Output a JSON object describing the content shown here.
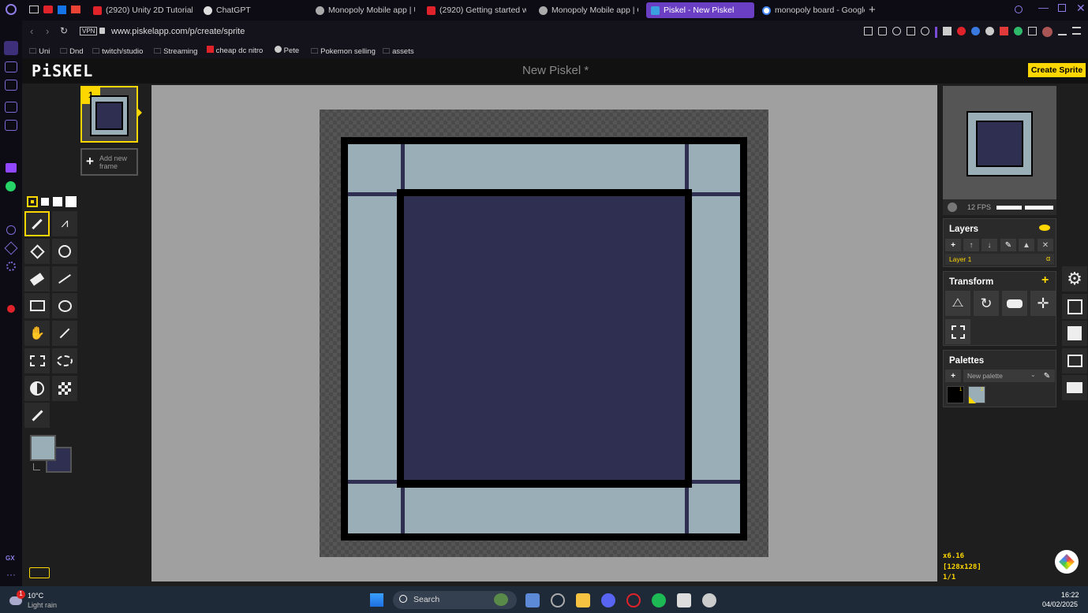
{
  "browser": {
    "tabs": [
      {
        "label": "(2920) Unity 2D Tutorial H",
        "color": "#e0222a"
      },
      {
        "label": "ChatGPT",
        "color": "#cccccc"
      },
      {
        "label": "Monopoly Mobile app | Un",
        "color": "#bbbbbb"
      },
      {
        "label": "(2920) Getting started wit",
        "color": "#e0222a"
      },
      {
        "label": "Monopoly Mobile app | Or",
        "color": "#bbbbbb"
      },
      {
        "label": "Piskel - New Piskel",
        "color": "#3aa0e0",
        "active": true
      },
      {
        "label": "monopoly board - Google",
        "color": "#4285f4"
      }
    ],
    "url": "www.piskelapp.com/p/create/sprite",
    "vpn_label": "VPN",
    "bookmarks": [
      "Uni",
      "Dnd",
      "twitch/studio",
      "Streaming",
      "cheap dc nitro",
      "Pete",
      "Pokemon selling",
      "assets"
    ]
  },
  "piskel": {
    "logo": "PiSKEL",
    "doc_title": "New Piskel *",
    "create_sprite_label": "Create Sprite",
    "frame_number": "1",
    "add_frame_label": "Add new frame",
    "fps": "12 FPS",
    "layers": {
      "title": "Layers",
      "items": [
        "Layer 1"
      ],
      "alpha_symbol": "α"
    },
    "transform": {
      "title": "Transform"
    },
    "palettes": {
      "title": "Palettes",
      "selected": "New palette",
      "swatch_numbers": [
        "1",
        "2"
      ]
    },
    "zoom_readout": "x6.16",
    "size_readout": "[128x128]",
    "frame_readout": "1/1",
    "colors": {
      "primary": "#9aaeb8",
      "secondary": "#2f2f52",
      "accent": "#ffd700"
    }
  },
  "taskbar": {
    "weather_temp": "10°C",
    "weather_desc": "Light rain",
    "weather_badge": "1",
    "search_placeholder": "Search",
    "time": "16:22",
    "date": "04/02/2025"
  }
}
